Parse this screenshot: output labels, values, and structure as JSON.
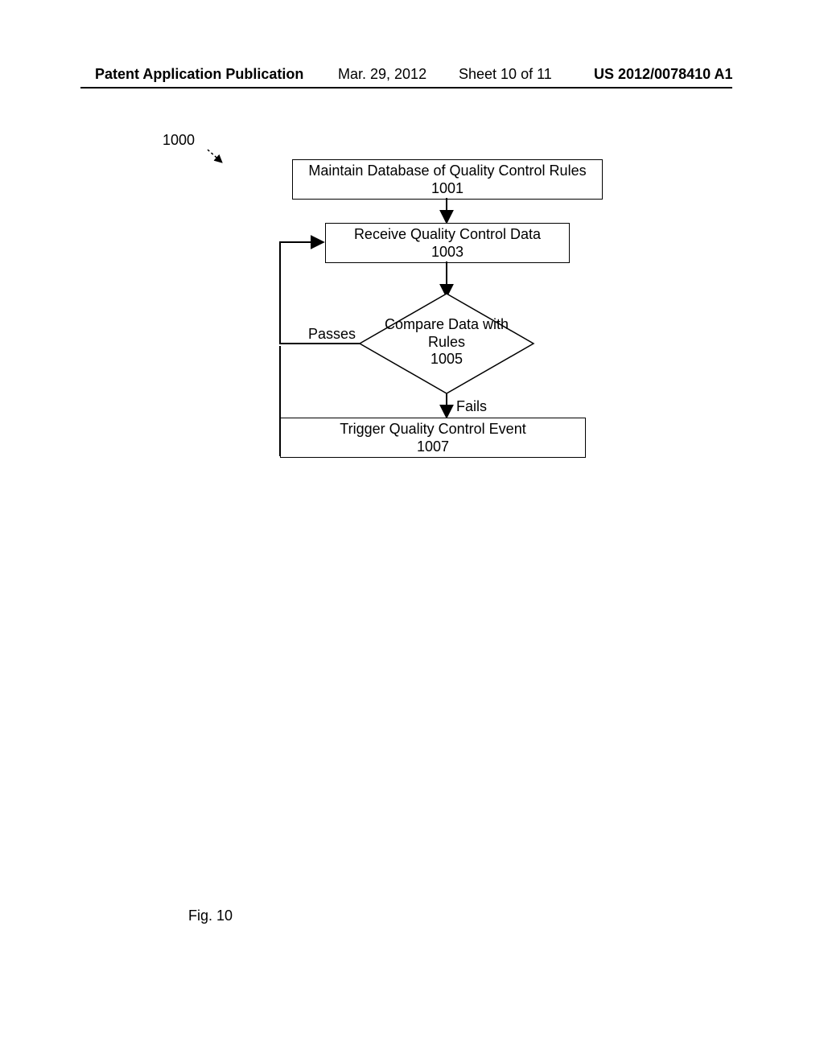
{
  "header": {
    "publication": "Patent Application Publication",
    "date": "Mar. 29, 2012",
    "sheet": "Sheet 10 of 11",
    "docnum": "US 2012/0078410 A1"
  },
  "flow_ref": "1000",
  "steps": {
    "s1001": {
      "title": "Maintain Database of Quality Control Rules",
      "num": "1001"
    },
    "s1003": {
      "title": "Receive Quality Control Data",
      "num": "1003"
    },
    "s1005": {
      "line1": "Compare Data with",
      "line2": "Rules",
      "num": "1005"
    },
    "s1007": {
      "title": "Trigger Quality Control Event",
      "num": "1007"
    }
  },
  "edges": {
    "passes": "Passes",
    "fails": "Fails"
  },
  "figure_caption": "Fig. 10"
}
